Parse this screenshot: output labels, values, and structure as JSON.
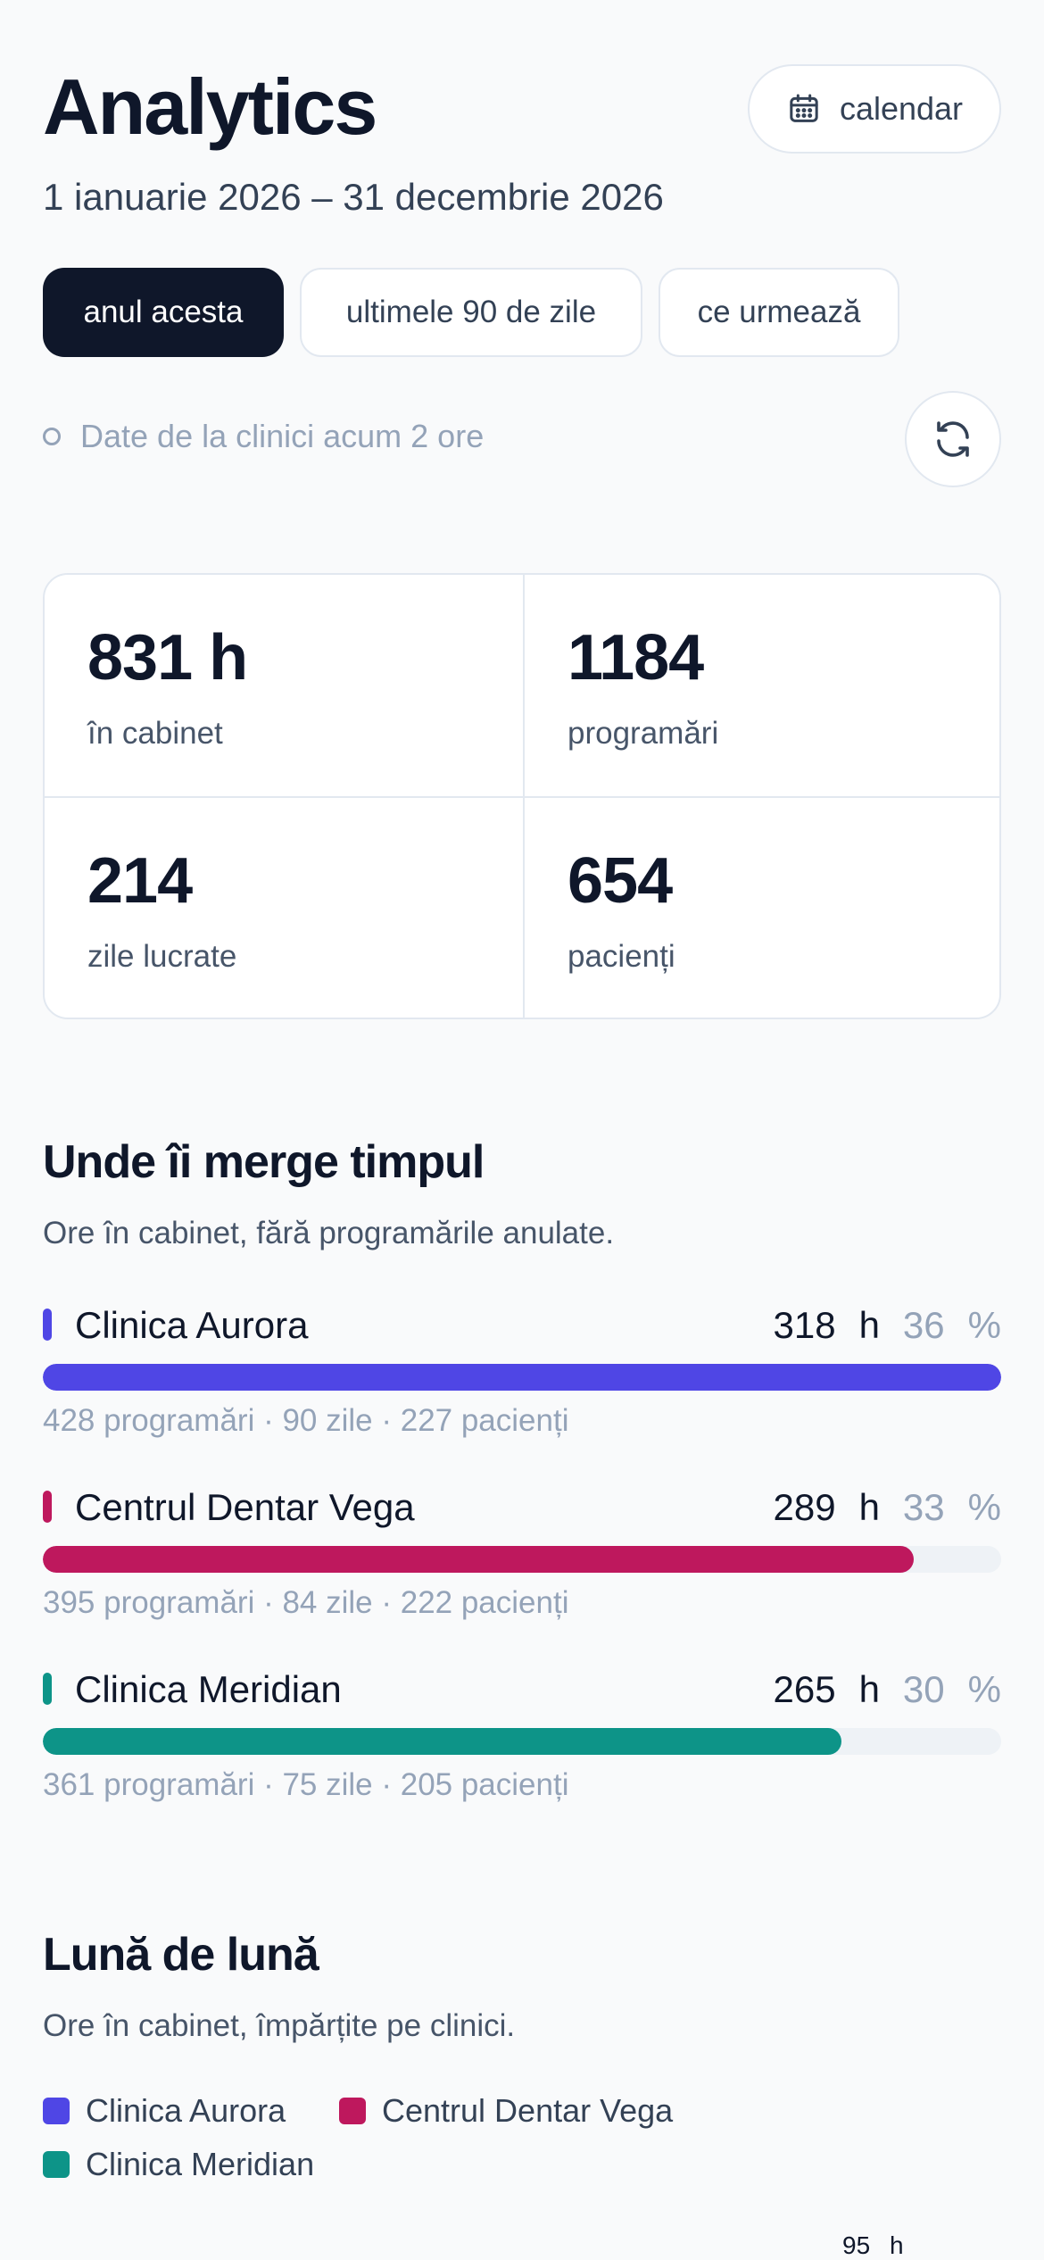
{
  "header": {
    "title": "Analytics",
    "date_range": "1 ianuarie 2026 – 31 decembrie 2026",
    "calendar_label": "calendar"
  },
  "tabs": [
    {
      "label": "anul acesta",
      "active": true
    },
    {
      "label": "ultimele 90 de zile",
      "active": false
    },
    {
      "label": "ce urmează",
      "active": false
    }
  ],
  "status": {
    "text": "Date de la clinici acum 2 ore"
  },
  "stats": [
    {
      "value": "831 h",
      "label": "în cabinet"
    },
    {
      "value": "1184",
      "label": "programări"
    },
    {
      "value": "214",
      "label": "zile lucrate"
    },
    {
      "value": "654",
      "label": "pacienți"
    }
  ],
  "time_section": {
    "title": "Unde îi merge timpul",
    "subtitle": "Ore în cabinet, fără programările anulate."
  },
  "clinics": [
    {
      "name": "Clinica Aurora",
      "hours": "318",
      "hours_unit": "h",
      "percent": "36",
      "percent_unit": "%",
      "share": 1.0,
      "color": "#4f46e5",
      "meta": "428 programări · 90 zile · 227 pacienți"
    },
    {
      "name": "Centrul Dentar Vega",
      "hours": "289",
      "hours_unit": "h",
      "percent": "33",
      "percent_unit": "%",
      "share": 0.909,
      "color": "#be185d",
      "meta": "395 programări · 84 zile · 222 pacienți"
    },
    {
      "name": "Clinica Meridian",
      "hours": "265",
      "hours_unit": "h",
      "percent": "30",
      "percent_unit": "%",
      "share": 0.833,
      "color": "#0d9488",
      "meta": "361 programări · 75 zile · 205 pacienți"
    }
  ],
  "monthly_section": {
    "title": "Lună de lună",
    "subtitle": "Ore în cabinet, împărțite pe clinici.",
    "legend": [
      "Clinica Aurora",
      "Centrul Dentar Vega",
      "Clinica Meridian"
    ],
    "axis_top_value": "95",
    "axis_top_unit": "h"
  }
}
